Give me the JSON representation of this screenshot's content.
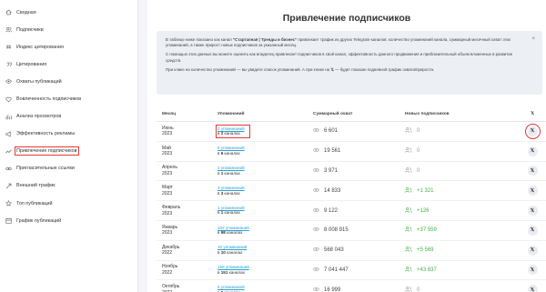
{
  "sidebar": {
    "items": [
      {
        "label": "Сводная",
        "icon": "home-icon"
      },
      {
        "label": "Подписчики",
        "icon": "users-icon"
      },
      {
        "label": "Индекс цитирования",
        "icon": "citation-icon"
      },
      {
        "label": "Цитирования",
        "icon": "quote-icon"
      },
      {
        "label": "Охваты публикаций",
        "icon": "eye-icon"
      },
      {
        "label": "Вовлеченность подписчиков",
        "icon": "heart-icon"
      },
      {
        "label": "Анализ просмотров",
        "icon": "chart-icon"
      },
      {
        "label": "Эффективность рекламы",
        "icon": "megaphone-icon"
      },
      {
        "label": "Привлечение подписчиков",
        "icon": "trend-icon"
      },
      {
        "label": "Пригласительные ссылки",
        "icon": "link-icon"
      },
      {
        "label": "Внешний трафик",
        "icon": "external-icon"
      },
      {
        "label": "Топ публикаций",
        "icon": "top-icon"
      },
      {
        "label": "График публикаций",
        "icon": "calendar-icon"
      }
    ]
  },
  "main": {
    "title": "Привлечение подписчиков",
    "info": {
      "p1_pre": "В таблице ниже показано как канал ",
      "p1_channel": "\"Стартапная | Тренды и бизнес\"",
      "p1_post": " привлекает трафик из других Telegram-каналов: количество упоминаний канала, суммарный месячный охват этих упоминаний, а также прирост новых подписчиков за указанный месяц.",
      "p2": "С помощью этих данных вы можете оценить как владелец привлекает подписчиков в свой канал, эффективность данного продвижения и приблизительный объем вложенных в развитие средств.",
      "p3_pre": "При клике на количество упоминаний — вы увидите список упоминаний. А при клике на ",
      "p3_x": "𝕏",
      "p3_post": " — будет показан подневной график охвата/прироста.",
      "close": "×"
    },
    "table": {
      "headers": [
        "Месяц",
        "Упоминаний",
        "Суммарный охват",
        "Новых подписчиков",
        "𝕏"
      ],
      "rows": [
        {
          "month": "Июнь",
          "year": "2023",
          "mentions": "2 упоминаний",
          "ch_pre": "в ",
          "ch_num": "2",
          "ch_post": " каналах",
          "reach": "6 601",
          "subs": "0",
          "subs_color": "#999999",
          "x": "𝕏"
        },
        {
          "month": "Май",
          "year": "2023",
          "mentions": "6 упоминаний",
          "ch_pre": "в ",
          "ch_num": "6",
          "ch_post": " каналах",
          "reach": "19 561",
          "subs": "0",
          "subs_color": "#999999",
          "x": "𝕏"
        },
        {
          "month": "Апрель",
          "year": "2023",
          "mentions": "2 упоминаний",
          "ch_pre": "в ",
          "ch_num": "1",
          "ch_post": " каналах",
          "reach": "3 971",
          "subs": "0",
          "subs_color": "#999999",
          "x": "𝕏"
        },
        {
          "month": "Март",
          "year": "2023",
          "mentions": "3 упоминаний",
          "ch_pre": "в ",
          "ch_num": "3",
          "ch_post": " каналах",
          "reach": "14 833",
          "subs": "+1 321",
          "subs_color": "#43b049",
          "x": "𝕏"
        },
        {
          "month": "Февраль",
          "year": "2023",
          "mentions": "1 упоминаний",
          "ch_pre": "в ",
          "ch_num": "1",
          "ch_post": " каналах",
          "reach": "9 122",
          "subs": "+126",
          "subs_color": "#43b049",
          "x": "𝕏"
        },
        {
          "month": "Январь",
          "year": "2023",
          "mentions": "102 упоминаний",
          "ch_pre": "в ",
          "ch_num": "98",
          "ch_post": " каналах",
          "reach": "8 008 915",
          "subs": "+37 559",
          "subs_color": "#43b049",
          "x": "𝕏"
        },
        {
          "month": "Декабрь",
          "year": "2022",
          "mentions": "10 упоминаний",
          "ch_pre": "в ",
          "ch_num": "10",
          "ch_post": " каналах",
          "reach": "568 043",
          "subs": "+5 569",
          "subs_color": "#43b049",
          "x": "𝕏"
        },
        {
          "month": "Ноябрь",
          "year": "2022",
          "mentions": "158 упоминаний",
          "ch_pre": "в ",
          "ch_num": "151",
          "ch_post": " каналах",
          "reach": "7 041 447",
          "subs": "+43 837",
          "subs_color": "#43b049",
          "x": "𝕏"
        },
        {
          "month": "Октябрь",
          "year": "2022",
          "mentions": "5 упоминаний",
          "ch_pre": "в ",
          "ch_num": "5",
          "ch_post": " каналах",
          "reach": "16 999",
          "subs": "0",
          "subs_color": "#999999",
          "x": "𝕏"
        }
      ]
    }
  },
  "colors": {
    "accent": "#2a9fd6",
    "positive": "#43b049",
    "highlight": "#e53935",
    "panel": "#eceff4"
  }
}
